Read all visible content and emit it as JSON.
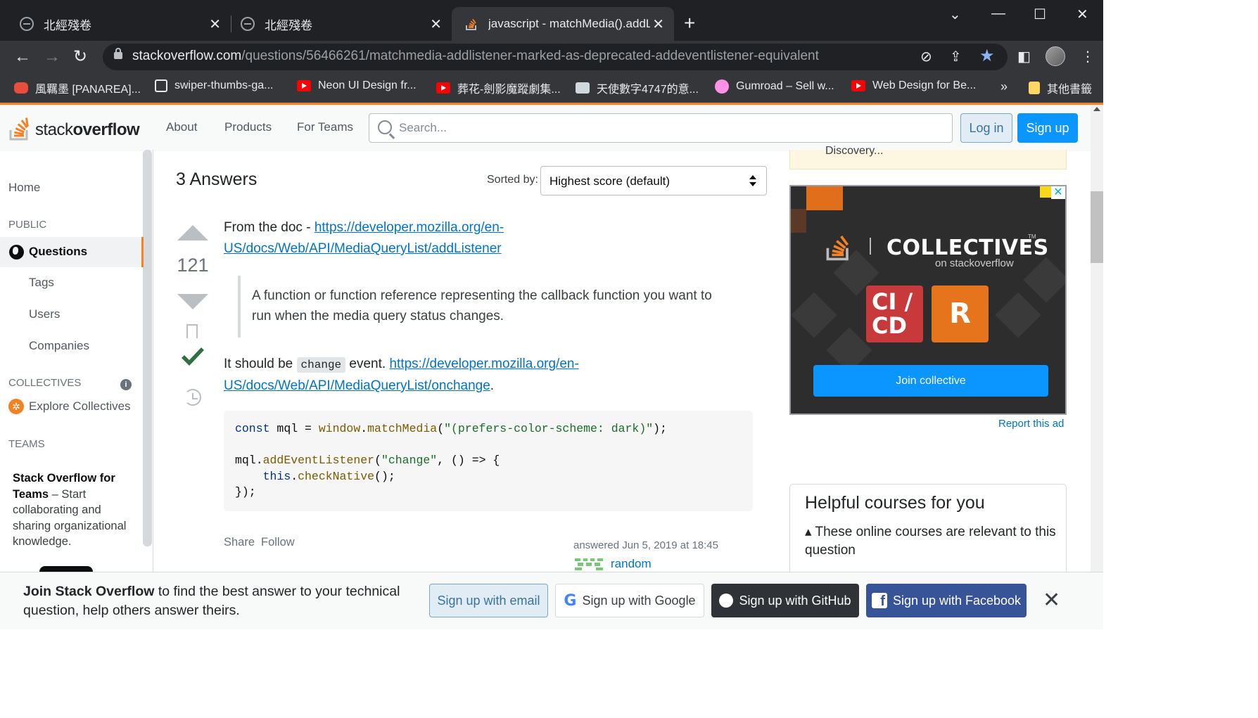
{
  "browser": {
    "tabs": [
      {
        "title": "北經殘卷",
        "close": "✕"
      },
      {
        "title": "北經殘卷",
        "close": "✕"
      },
      {
        "title": "javascript - matchMedia().addLi",
        "close": "✕"
      }
    ],
    "new_tab": "+",
    "window_controls": {
      "menu": "⌄",
      "minimize": "—",
      "maximize": "☐",
      "close": "✕"
    },
    "url_host": "stackoverflow.com",
    "url_path": "/questions/56466261/matchmedia-addlistener-marked-as-deprecated-addeventlistener-equivalent",
    "bookmarks": [
      {
        "label": "風羈墨 [PANAREA]...",
        "icon": "red-app-icon"
      },
      {
        "label": "swiper-thumbs-ga...",
        "icon": "page-icon"
      },
      {
        "label": "Neon UI Design fr...",
        "icon": "youtube-icon"
      },
      {
        "label": "葬花-劍影魔蹤劇集...",
        "icon": "youtube-icon"
      },
      {
        "label": "天使數字4747的意...",
        "icon": "image-icon"
      },
      {
        "label": "Gumroad – Sell w...",
        "icon": "gumroad-icon"
      },
      {
        "label": "Web Design for Be...",
        "icon": "youtube-icon"
      }
    ],
    "bookmarks_overflow": "»",
    "other_bookmarks": "其他書籤"
  },
  "so_header": {
    "logo_light": "stack",
    "logo_bold": "overflow",
    "nav": [
      "About",
      "Products",
      "For Teams"
    ],
    "search_placeholder": "Search...",
    "login": "Log in",
    "signup": "Sign up"
  },
  "leftnav": {
    "home": "Home",
    "public": "PUBLIC",
    "questions": "Questions",
    "tags": "Tags",
    "users": "Users",
    "companies": "Companies",
    "collectives": "COLLECTIVES",
    "info": "i",
    "explore": "Explore Collectives",
    "teams": "TEAMS",
    "teams_title": "Stack Overflow for Teams",
    "teams_desc": " – Start collaborating and sharing organizational knowledge."
  },
  "answers": {
    "heading": "3 Answers",
    "sorted_by": "Sorted by:",
    "sort_value": "Highest score (default)",
    "score": "121",
    "p1_prefix": "From the doc - ",
    "p1_link_line1": "https://developer.mozilla.org/en-",
    "p1_link_line2": "US/docs/Web/API/MediaQueryList/addListener",
    "quote": "A function or function reference representing the callback function you want to run when the media query status changes.",
    "p2_prefix": "It should be ",
    "p2_code": "change",
    "p2_mid": " event. ",
    "p2_link_line1": "https://developer.mozilla.org/en-",
    "p2_link_line2": "US/docs/Web/API/MediaQueryList/onchange",
    "p2_suffix": ".",
    "code": {
      "l1_kw": "const",
      "l1_var": " mql = ",
      "l1_obj": "window",
      "l1_dot": ".",
      "l1_fn": "matchMedia",
      "l1_open": "(",
      "l1_str": "\"(prefers-color-scheme: dark)\"",
      "l1_close": ");",
      "l2_var": "mql",
      "l2_dot": ".",
      "l2_fn": "addEventListener",
      "l2_open": "(",
      "l2_str": "\"change\"",
      "l2_rest": ", () => {",
      "l3_indent": "    ",
      "l3_kw": "this",
      "l3_dot": ".",
      "l3_fn": "checkNative",
      "l3_rest": "();",
      "l4": "});"
    },
    "share": "Share",
    "follow": "Follow",
    "answered": "answered Jun 5, 2019 at 18:45",
    "user": "random"
  },
  "sidebar": {
    "discovery": "Discovery...",
    "ad_title": "COLLECTIVES",
    "ad_tm": "TM",
    "ad_sub": "on stackoverflow",
    "ad_tile1": "CI / CD",
    "ad_tile2": "R",
    "ad_join": "Join collective",
    "ad_close": "✕",
    "report_ad": "Report this ad",
    "courses_title": "Helpful courses for you",
    "courses_sub": "These online courses are relevant to this question"
  },
  "banner": {
    "bold": "Join Stack Overflow",
    "text": " to find the best answer to your technical question, help others answer theirs.",
    "email": "Sign up with email",
    "google": "Sign up with Google",
    "github": "Sign up with GitHub",
    "facebook": "Sign up with Facebook",
    "google_g": "G",
    "facebook_f": "f",
    "close": "✕"
  },
  "colors": {
    "so_orange": "#f48225",
    "so_blue": "#0a95ff",
    "link": "#0074cc",
    "accepted": "#2f6f44"
  }
}
